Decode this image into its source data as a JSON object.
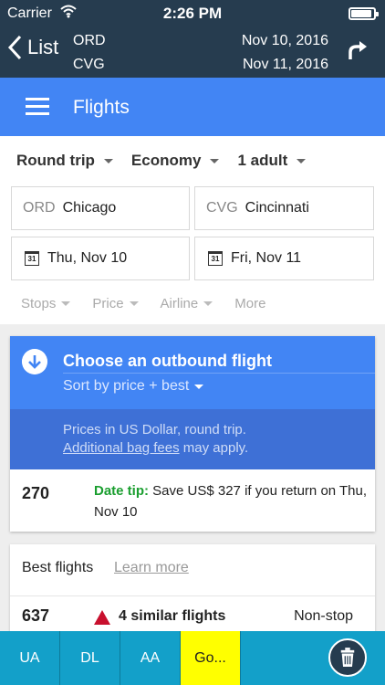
{
  "status_bar": {
    "carrier": "Carrier",
    "time": "2:26 PM",
    "battery_level": 0.9
  },
  "nav": {
    "back_label": "List",
    "origin": "ORD",
    "destination": "CVG",
    "depart_date": "Nov 10, 2016",
    "return_date": "Nov 11, 2016"
  },
  "appbar": {
    "title": "Flights"
  },
  "search": {
    "trip_type": "Round trip",
    "cabin": "Economy",
    "passengers": "1 adult",
    "origin": {
      "code": "ORD",
      "city": "Chicago"
    },
    "destination": {
      "code": "CVG",
      "city": "Cincinnati"
    },
    "depart": "Thu, Nov 10",
    "return": "Fri, Nov 11",
    "calendar_day": "31",
    "filters": [
      "Stops",
      "Price",
      "Airline",
      "More"
    ]
  },
  "outbound": {
    "title": "Choose an outbound flight",
    "sort_label": "Sort by price + best",
    "note_prefix": "Prices in US Dollar, round trip.",
    "note_link": "Additional bag fees",
    "note_suffix": "may apply.",
    "tip_price": "270",
    "tip_label": "Date tip:",
    "tip_text": "Save US$ 327 if you return on Thu, Nov 10"
  },
  "best_flights": {
    "title": "Best flights",
    "learn_more": "Learn more",
    "rows": [
      {
        "price": "637",
        "label": "4 similar flights",
        "stops": "Non-stop"
      }
    ]
  },
  "tabs": [
    {
      "label": "UA",
      "active": false
    },
    {
      "label": "DL",
      "active": false
    },
    {
      "label": "AA",
      "active": false
    },
    {
      "label": "Go...",
      "active": true
    }
  ],
  "colors": {
    "nav_bg": "#263c4f",
    "app_blue": "#4285f4",
    "note_blue": "#3e70d6",
    "tip_green": "#1a9e2f",
    "tab_bg": "#13a0c9",
    "tab_active": "#ffff00",
    "delta_red": "#c8102e"
  },
  "icons": [
    "wifi-icon",
    "battery-icon",
    "chevron-left-icon",
    "refresh-icon",
    "hamburger-icon",
    "calendar-icon",
    "arrow-down-circle-icon",
    "delta-logo-icon",
    "trash-icon"
  ]
}
